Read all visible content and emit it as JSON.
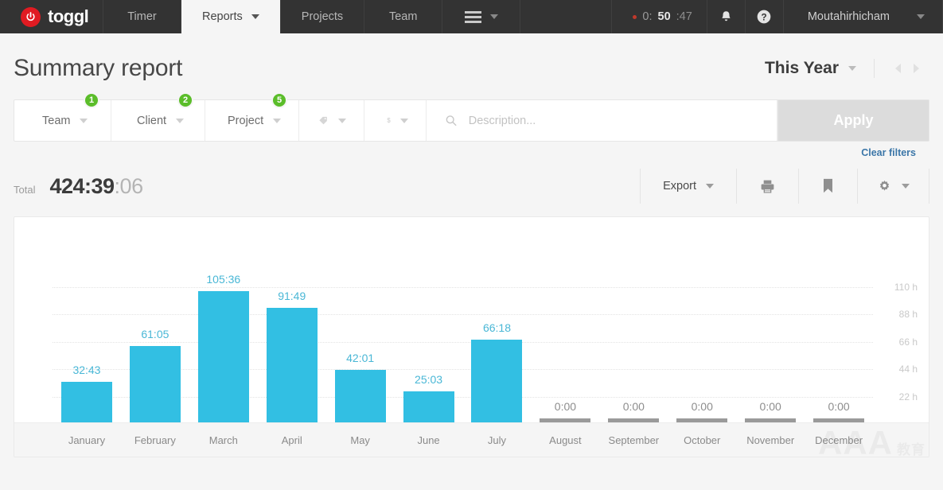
{
  "topnav": {
    "brand": "toggl",
    "items": [
      {
        "label": "Timer",
        "active": false
      },
      {
        "label": "Reports",
        "active": true
      },
      {
        "label": "Projects",
        "active": false
      },
      {
        "label": "Team",
        "active": false
      }
    ],
    "menu_icon": "hamburger-icon",
    "timer": {
      "prefix": "0:",
      "highlight": "50",
      "suffix": ":47",
      "recording": true
    },
    "notifications_icon": "bell-icon",
    "help_icon": "question-mark-icon",
    "user": "Moutahirhicham"
  },
  "header": {
    "title": "Summary report",
    "date_range": "This Year",
    "prev_icon": "chevron-left-icon",
    "next_icon": "chevron-right-icon"
  },
  "filters": {
    "team": {
      "label": "Team",
      "badge": "1"
    },
    "client": {
      "label": "Client",
      "badge": "2"
    },
    "project": {
      "label": "Project",
      "badge": "5"
    },
    "tag": {
      "icon": "tag-icon"
    },
    "billable": {
      "icon": "dollar-icon"
    },
    "description": {
      "placeholder": "Description...",
      "value": "",
      "icon": "search-icon"
    },
    "apply_label": "Apply",
    "clear_label": "Clear filters"
  },
  "summary": {
    "total_label": "Total",
    "total_main": "424:39",
    "total_seconds": ":06",
    "export_label": "Export",
    "print_icon": "printer-icon",
    "bookmark_icon": "bookmark-icon",
    "settings_icon": "gear-icon"
  },
  "watermark": {
    "text": "AAA",
    "sub": "教育"
  },
  "chart_data": {
    "type": "bar",
    "title": "Summary report",
    "xlabel": "",
    "ylabel": "Hours",
    "categories": [
      "January",
      "February",
      "March",
      "April",
      "May",
      "June",
      "July",
      "August",
      "September",
      "October",
      "November",
      "December"
    ],
    "values": [
      32.72,
      61.08,
      105.6,
      91.82,
      42.02,
      25.05,
      66.3,
      0,
      0,
      0,
      0,
      0
    ],
    "value_labels": [
      "32:43",
      "61:05",
      "105:36",
      "91:49",
      "42:01",
      "25:03",
      "66:18",
      "0:00",
      "0:00",
      "0:00",
      "0:00",
      "0:00"
    ],
    "ytick_labels": [
      "110 h",
      "88 h",
      "66 h",
      "44 h",
      "22 h"
    ],
    "yticks": [
      110,
      88,
      66,
      44,
      22
    ],
    "ylim": [
      0,
      110
    ],
    "grid": true,
    "legend": "none",
    "bar_color": "#32bfe3",
    "empty_bar_color": "#9a9a9a",
    "label_color": "#49b7d6"
  }
}
